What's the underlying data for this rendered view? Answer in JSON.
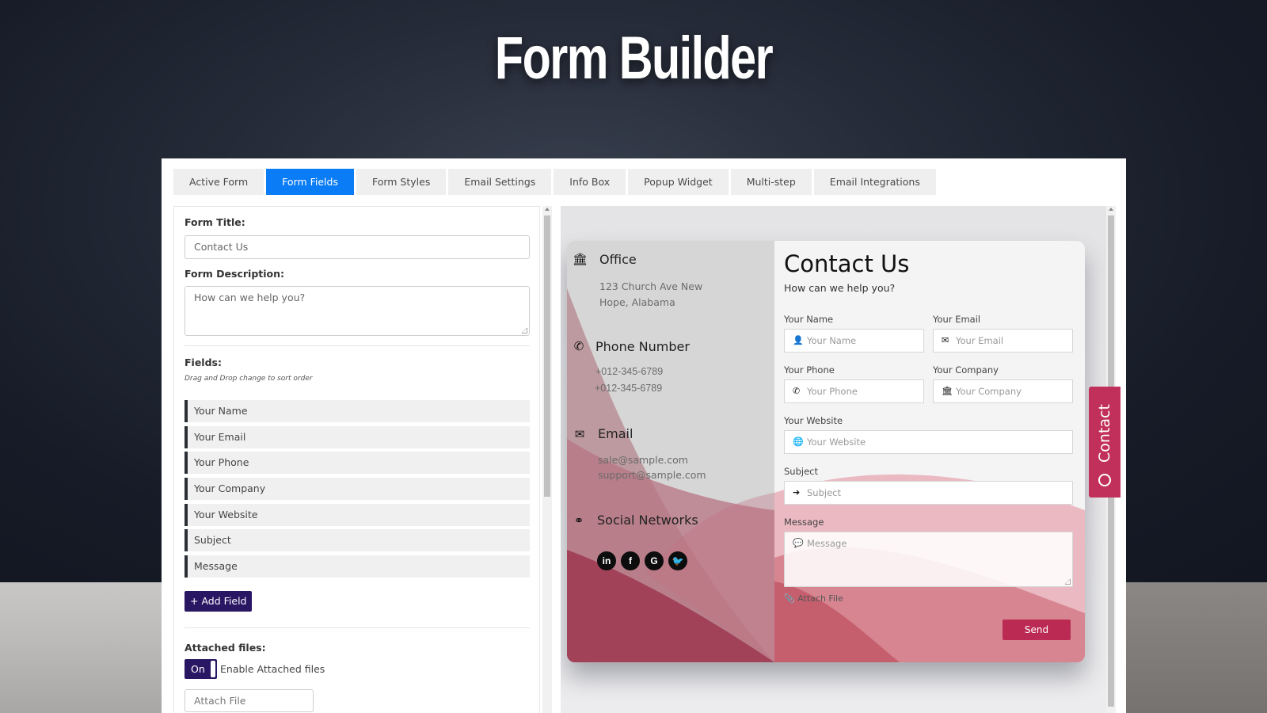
{
  "page": {
    "title": "Form Builder"
  },
  "tabs": [
    {
      "label": "Active Form",
      "active": false
    },
    {
      "label": "Form Fields",
      "active": true
    },
    {
      "label": "Form Styles",
      "active": false
    },
    {
      "label": "Email Settings",
      "active": false
    },
    {
      "label": "Info Box",
      "active": false
    },
    {
      "label": "Popup Widget",
      "active": false
    },
    {
      "label": "Multi-step",
      "active": false
    },
    {
      "label": "Email Integrations",
      "active": false
    }
  ],
  "settings": {
    "form_title_label": "Form Title:",
    "form_title_value": "Contact Us",
    "form_description_label": "Form Description:",
    "form_description_value": "How can we help you?",
    "fields_label": "Fields:",
    "fields_hint": "Drag and Drop change to sort order",
    "fields": [
      "Your Name",
      "Your Email",
      "Your Phone",
      "Your Company",
      "Your Website",
      "Subject",
      "Message"
    ],
    "add_field_label": "+ Add Field",
    "attached_files_label": "Attached files:",
    "toggle_state": "On",
    "toggle_description": "Enable Attached files",
    "attach_file_value": "Attach File"
  },
  "preview": {
    "info": {
      "office": {
        "icon": "bank-icon",
        "heading": "Office",
        "lines": [
          "123 Church Ave New",
          "Hope, Alabama"
        ]
      },
      "phone": {
        "icon": "phone-icon",
        "heading": "Phone Number",
        "lines": [
          "+012-345-6789",
          "+012-345-6789"
        ]
      },
      "email": {
        "icon": "envelope-icon",
        "heading": "Email",
        "lines": [
          "sale@sample.com",
          "support@sample.com"
        ]
      },
      "social": {
        "icon": "link-icon",
        "heading": "Social Networks",
        "networks": [
          {
            "name": "linkedin",
            "glyph": "in"
          },
          {
            "name": "facebook",
            "glyph": "f"
          },
          {
            "name": "google",
            "glyph": "G"
          },
          {
            "name": "twitter",
            "glyph": "t"
          }
        ]
      }
    },
    "form": {
      "title": "Contact Us",
      "description": "How can we help you?",
      "fields": {
        "name": {
          "label": "Your Name",
          "placeholder": "Your Name",
          "icon": "user-icon"
        },
        "email": {
          "label": "Your Email",
          "placeholder": "Your Email",
          "icon": "envelope-icon"
        },
        "phone": {
          "label": "Your Phone",
          "placeholder": "Your Phone",
          "icon": "phone-icon"
        },
        "company": {
          "label": "Your Company",
          "placeholder": "Your Company",
          "icon": "bank-icon"
        },
        "website": {
          "label": "Your Website",
          "placeholder": "Your Website",
          "icon": "globe-icon"
        },
        "subject": {
          "label": "Subject",
          "placeholder": "Subject",
          "icon": "arrow-right-icon"
        },
        "message": {
          "label": "Message",
          "placeholder": "Message",
          "icon": "comment-icon"
        }
      },
      "attach_label": "Attach File",
      "send_label": "Send"
    },
    "widget_tab_label": "Contact"
  },
  "colors": {
    "active_tab": "#0a7cf5",
    "primary_button": "#2a1763",
    "send_button": "#bb2a52",
    "widget_tab": "#c1305a"
  }
}
